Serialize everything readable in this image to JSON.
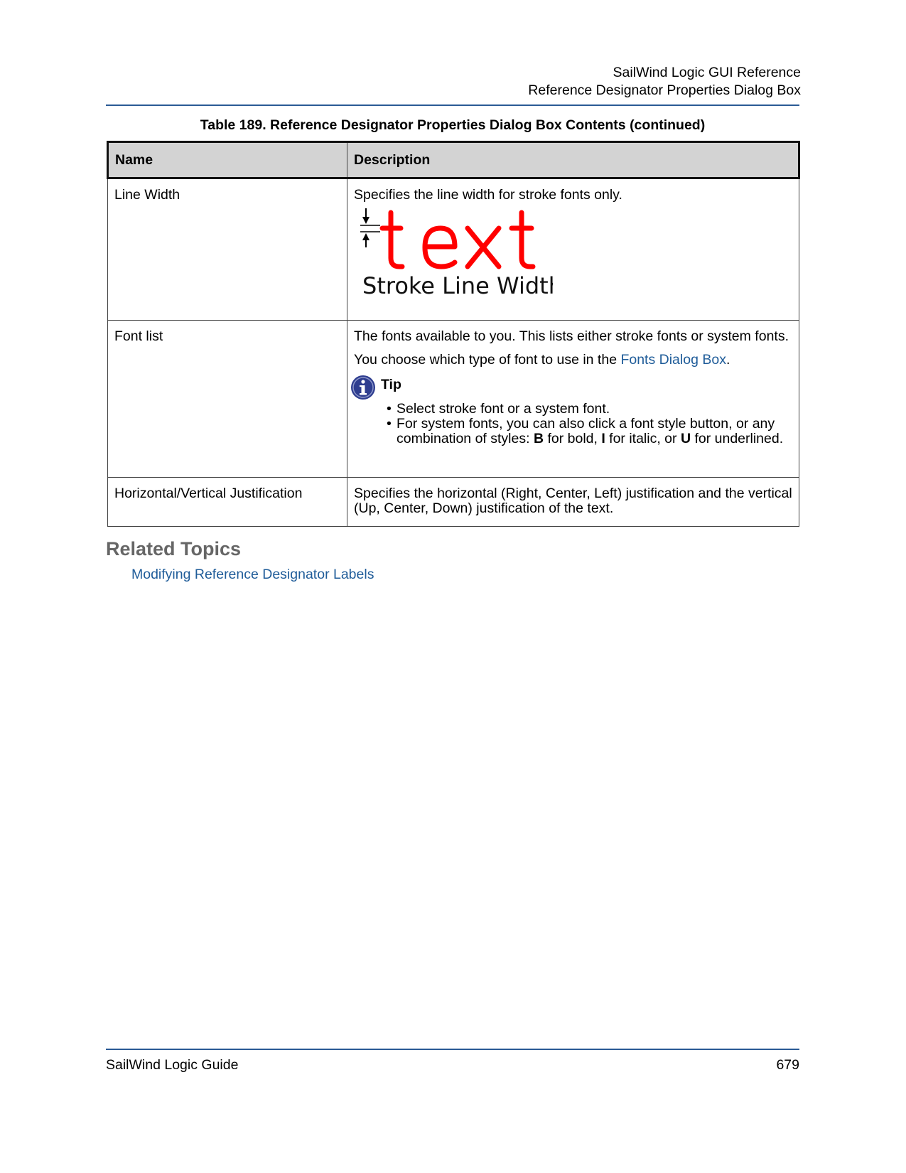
{
  "header": {
    "line1": "SailWind Logic GUI Reference",
    "line2": "Reference Designator Properties Dialog Box"
  },
  "table": {
    "caption": "Table 189. Reference Designator Properties Dialog Box Contents (continued)",
    "columns": [
      "Name",
      "Description"
    ],
    "rows": [
      {
        "name": "Line Width",
        "description": "Specifies the line width for stroke fonts only.",
        "illustration": {
          "sample_text": "text",
          "caption": "Stroke Line Width",
          "text_color": "#ff0000"
        }
      },
      {
        "name": "Font list",
        "description": "The fonts available to you. This lists either stroke fonts or system fonts.",
        "description2_pre": "You choose which type of font to use in the ",
        "description2_link": "Fonts Dialog Box",
        "description2_post": ".",
        "tip_label": "Tip",
        "tip_items": [
          "Select stroke font or a system font.",
          {
            "t1": "For system fonts, you can also click a font style button, or any combination of styles: ",
            "b1": "B",
            "t2": " for bold, ",
            "b2": "I",
            "t3": " for italic, or ",
            "b3": "U",
            "t4": " for underlined."
          }
        ]
      },
      {
        "name": "Horizontal/Vertical Justification",
        "description": "Specifies the horizontal (Right, Center, Left) justification and the vertical (Up, Center, Down) justification of the text."
      }
    ]
  },
  "related": {
    "title": "Related Topics",
    "links": [
      "Modifying Reference Designator Labels"
    ]
  },
  "footer": {
    "left": "SailWind Logic Guide",
    "page_number": "679"
  },
  "colors": {
    "rule": "#2a5a95",
    "link": "#1f5c99",
    "header_bg": "#d3d3d3",
    "tip_icon": "#2e3d8f"
  },
  "icons": {
    "tip": "info-icon",
    "arrows": "dimension-arrows-icon"
  }
}
